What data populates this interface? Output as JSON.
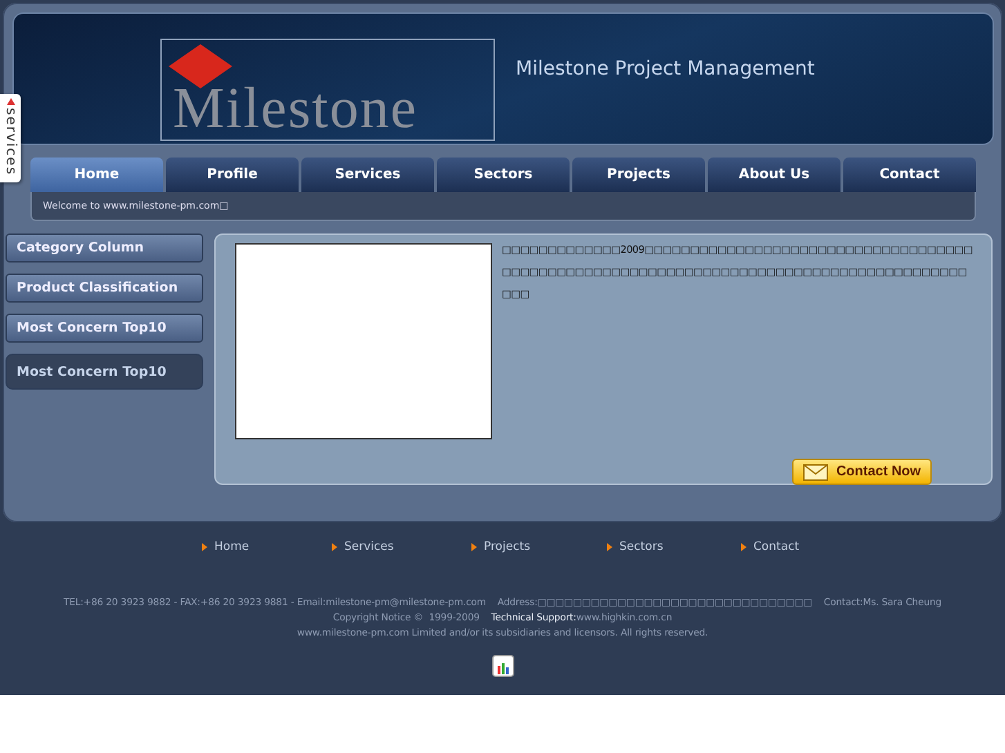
{
  "side_tab": {
    "label": "services"
  },
  "header": {
    "logo": "Milestone",
    "title": "Milestone Project Management"
  },
  "nav": [
    {
      "label": "Home",
      "selected": true
    },
    {
      "label": "Profile",
      "selected": false
    },
    {
      "label": "Services",
      "selected": false
    },
    {
      "label": "Sectors",
      "selected": false
    },
    {
      "label": "Projects",
      "selected": false
    },
    {
      "label": "About Us",
      "selected": false
    },
    {
      "label": "Contact",
      "selected": false
    }
  ],
  "welcome": "Welcome to www.milestone-pm.com□",
  "sidebar": [
    {
      "label": "Category Column",
      "selected": false
    },
    {
      "label": "Product Classification",
      "selected": false
    },
    {
      "label": "Most Concern Top10",
      "selected": false
    },
    {
      "label": "Most Concern Top10",
      "selected": true
    }
  ],
  "content": {
    "text": "□□□□□□□□□□□□□2009□□□□□□□□□□□□□□□□□□□□□□□□□□□□□□□□□□□□□□□□□□□□□□□□□□□□□□□□□□□□□□□□□□□□□□□□□□□□□□□□□□□□□□□□□□",
    "button": "Contact Now"
  },
  "footer": {
    "links": [
      "Home",
      "Services",
      "Projects",
      "Sectors",
      "Contact"
    ],
    "contact": "TEL:+86 20 3923 9882 - FAX:+86 20 3923 9881 - Email:milestone-pm@milestone-pm.com    Address:□□□□□□□□□□□□□□□□□□□□□□□□□□□□□□□    Contact:Ms. Sara Cheung",
    "copyright": "Copyright Notice ©  1999-2009",
    "support_label": "Technical Support:",
    "support_url": "www.highkin.com.cn",
    "rights": "www.milestone-pm.com Limited and/or its subsidiaries and licensors. All rights reserved."
  }
}
